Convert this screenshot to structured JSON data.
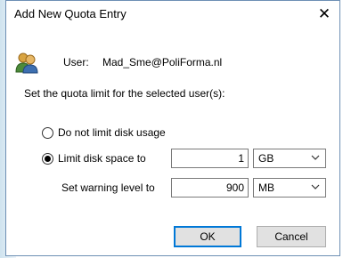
{
  "dialog": {
    "title": "Add New Quota Entry",
    "close_glyph": "✕"
  },
  "user": {
    "label": "User:",
    "value": "Mad_Sme@PoliForma.nl",
    "icon": "users-icon"
  },
  "instruction": "Set the quota limit for the selected user(s):",
  "options": {
    "no_limit_label": "Do not limit disk usage",
    "no_limit_checked": false,
    "limit_label": "Limit disk space to",
    "limit_checked": true,
    "limit_value": "1",
    "limit_unit": "GB",
    "warning_label": "Set warning level to",
    "warning_value": "900",
    "warning_unit": "MB"
  },
  "buttons": {
    "ok": "OK",
    "cancel": "Cancel"
  },
  "colors": {
    "default_button_border": "#0078d7",
    "dialog_border": "#6d8fb4"
  }
}
